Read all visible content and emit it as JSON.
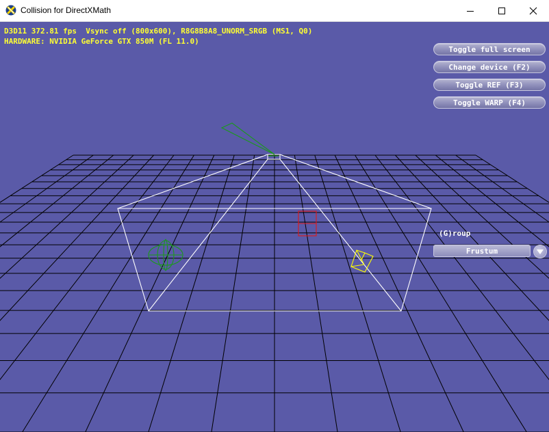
{
  "window": {
    "title": "Collision for DirectXMath"
  },
  "stats": {
    "line1": "D3D11 372.81 fps  Vsync off (800x600), R8G8B8A8_UNORM_SRGB (MS1, Q0)",
    "line2": "HARDWARE: NVIDIA GeForce GTX 850M (FL 11.0)"
  },
  "buttons": {
    "toggle_full_screen": "Toggle full screen",
    "change_device": "Change device (F2)",
    "toggle_ref": "Toggle REF (F3)",
    "toggle_warp": "Toggle WARP (F4)"
  },
  "group": {
    "label": "(G)roup",
    "selected": "Frustum"
  },
  "colors": {
    "background": "#5a5aa8",
    "stats_text": "#ffff33",
    "grid": "#000000",
    "frustum": "#ffffff",
    "sphere": "#1a9a1a",
    "box": "#e01818",
    "oriented_box": "#ffff00",
    "ray": "#1a9a1a"
  },
  "icons": {
    "app": "directx-icon",
    "minimize": "minimize-icon",
    "maximize": "maximize-icon",
    "close": "close-icon",
    "dropdown": "chevron-down-icon"
  }
}
